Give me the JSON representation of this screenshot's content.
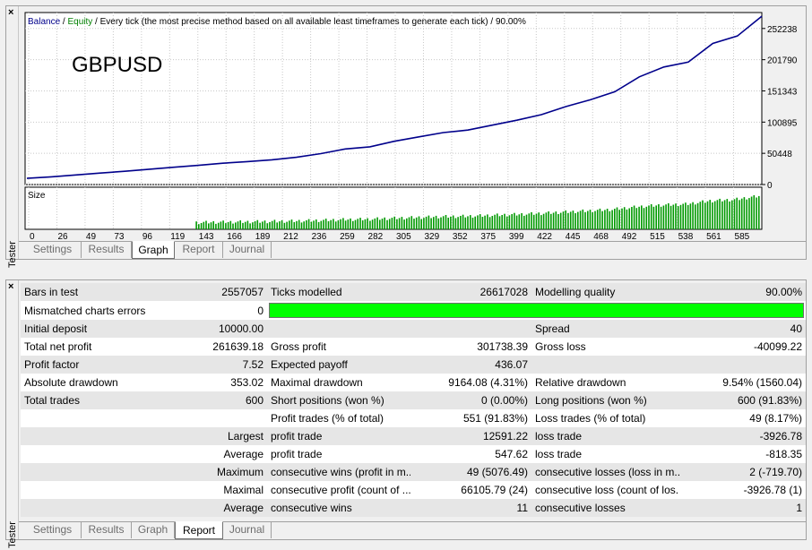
{
  "graph_panel": {
    "title": "Tester",
    "close": "×",
    "legend": {
      "balance": "Balance",
      "sep1": " / ",
      "equity": "Equity",
      "sep2": " / ",
      "desc": "Every tick (the most precise method based on all available least timeframes to generate each tick)",
      "quality": " / 90.00%"
    },
    "symbol": "GBPUSD",
    "size_label": "Size",
    "colors": {
      "balance": "#00008b",
      "equity": "#008000",
      "size_bars": "#009900",
      "grid": "#c8c8c8"
    },
    "tabs": [
      "Settings",
      "Results",
      "Graph",
      "Report",
      "Journal"
    ],
    "active_tab": "Graph"
  },
  "chart_data": {
    "type": "line",
    "series": [
      {
        "name": "Balance",
        "values": [
          10000,
          12500,
          15500,
          18500,
          21500,
          24800,
          28000,
          31000,
          34500,
          37000,
          40000,
          44000,
          50000,
          57500,
          61000,
          70000,
          77000,
          84000,
          88000,
          96000,
          104000,
          113000,
          126000,
          137000,
          150000,
          174000,
          190000,
          198000,
          228000,
          240000,
          272000
        ]
      }
    ],
    "x_ticks": [
      "0",
      "26",
      "49",
      "73",
      "96",
      "119",
      "143",
      "166",
      "189",
      "212",
      "236",
      "259",
      "282",
      "305",
      "329",
      "352",
      "375",
      "399",
      "422",
      "445",
      "468",
      "492",
      "515",
      "538",
      "561",
      "585"
    ],
    "y_ticks": [
      "252238",
      "201790",
      "151343",
      "100895",
      "50448",
      "0"
    ],
    "ylim": [
      0,
      278000
    ],
    "xlim": [
      0,
      600
    ],
    "size_bars_note": ""
  },
  "report_panel": {
    "title": "Tester",
    "close": "×",
    "tabs": [
      "Settings",
      "Results",
      "Graph",
      "Report",
      "Journal"
    ],
    "active_tab": "Report",
    "rows": [
      {
        "c1": "Bars in test",
        "c2": "2557057",
        "c3": "Ticks modelled",
        "c4": "26617028",
        "c5": "Modelling quality",
        "c6": "90.00%"
      },
      {
        "c1": "Mismatched charts errors",
        "c2": "0",
        "bar": true
      },
      {
        "c1": "Initial deposit",
        "c2": "10000.00",
        "c3": "",
        "c4": "",
        "c5": "Spread",
        "c6": "40"
      },
      {
        "c1": "Total net profit",
        "c2": "261639.18",
        "c3": "Gross profit",
        "c4": "301738.39",
        "c5": "Gross loss",
        "c6": "-40099.22"
      },
      {
        "c1": "Profit factor",
        "c2": "7.52",
        "c3": "Expected payoff",
        "c4": "436.07",
        "c5": "",
        "c6": ""
      },
      {
        "c1": "Absolute drawdown",
        "c2": "353.02",
        "c3": "Maximal drawdown",
        "c4": "9164.08 (4.31%)",
        "c5": "Relative drawdown",
        "c6": "9.54% (1560.04)"
      },
      {
        "c1": "Total trades",
        "c2": "600",
        "c3": "Short positions (won %)",
        "c4": "0 (0.00%)",
        "c5": "Long positions (won %)",
        "c6": "600 (91.83%)"
      },
      {
        "c1": "",
        "c2": "",
        "c3": "Profit trades (% of total)",
        "c4": "551 (91.83%)",
        "c5": "Loss trades (% of total)",
        "c6": "49 (8.17%)"
      },
      {
        "c1": "",
        "c2": "Largest",
        "c3": "profit trade",
        "c4": "12591.22",
        "c5": "loss trade",
        "c6": "-3926.78"
      },
      {
        "c1": "",
        "c2": "Average",
        "c3": "profit trade",
        "c4": "547.62",
        "c5": "loss trade",
        "c6": "-818.35"
      },
      {
        "c1": "",
        "c2": "Maximum",
        "c3": "consecutive wins (profit in m...",
        "c4": "49 (5076.49)",
        "c5": "consecutive losses (loss in m...",
        "c6": "2 (-719.70)"
      },
      {
        "c1": "",
        "c2": "Maximal",
        "c3": "consecutive profit (count of ...",
        "c4": "66105.79 (24)",
        "c5": "consecutive loss (count of los...",
        "c6": "-3926.78 (1)"
      },
      {
        "c1": "",
        "c2": "Average",
        "c3": "consecutive wins",
        "c4": "11",
        "c5": "consecutive losses",
        "c6": "1"
      }
    ]
  }
}
